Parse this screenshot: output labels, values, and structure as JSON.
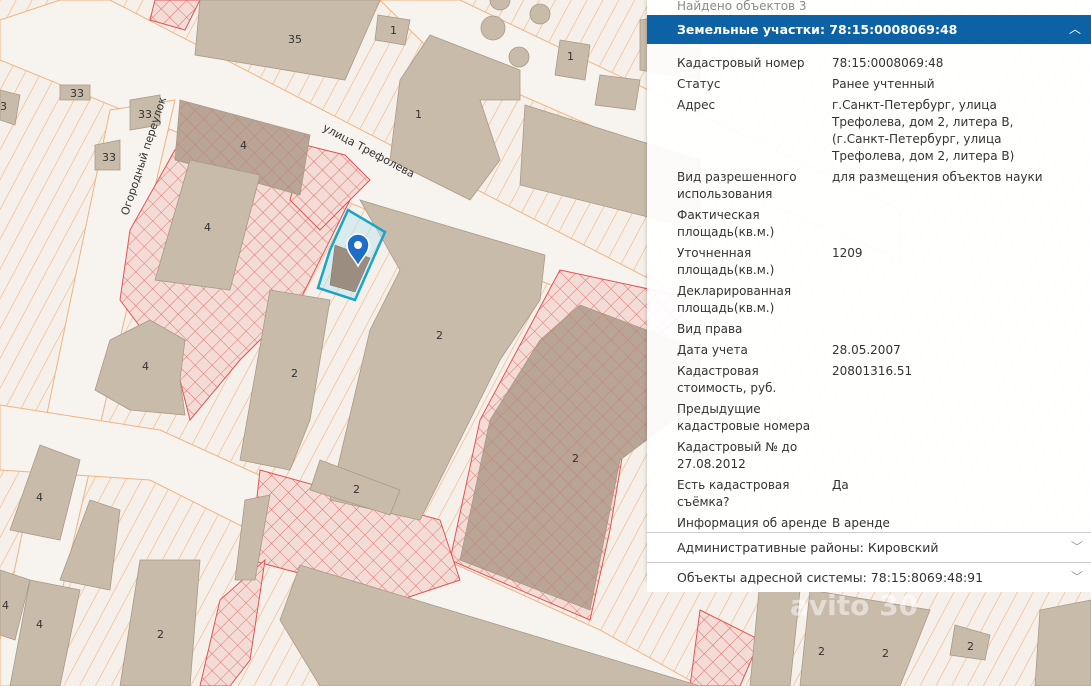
{
  "map": {
    "streets": [
      {
        "name": "улица Трефолева"
      },
      {
        "name": "Огородный переулок"
      }
    ],
    "building_numbers": [
      "35",
      "1",
      "1",
      "1",
      "33",
      "33",
      "33",
      "3",
      "4",
      "4",
      "4",
      "2",
      "2",
      "2",
      "2",
      "4",
      "4",
      "4",
      "2",
      "2",
      "2",
      "2"
    ],
    "watermark": "avito 30"
  },
  "panel": {
    "found_text": "Найдено объектов 3",
    "section_title": "Земельные участки: 78:15:0008069:48",
    "details": [
      {
        "label": "Кадастровый номер",
        "value": "78:15:0008069:48"
      },
      {
        "label": "Статус",
        "value": "Ранее учтенный"
      },
      {
        "label": "Адрес",
        "value": "г.Санкт-Петербург, улица Трефолева, дом 2, литера В, (г.Санкт-Петербург, улица Трефолева, дом 2, литера В)"
      },
      {
        "label": "Вид разрешенного использования",
        "value": "для размещения объектов науки"
      },
      {
        "label": "Фактическая площадь(кв.м.)",
        "value": ""
      },
      {
        "label": "Уточненная площадь(кв.м.)",
        "value": "1209"
      },
      {
        "label": "Декларированная площадь(кв.м.)",
        "value": ""
      },
      {
        "label": "Вид права",
        "value": ""
      },
      {
        "label": "Дата учета",
        "value": "28.05.2007"
      },
      {
        "label": "Кадастровая стоимость, руб.",
        "value": "20801316.51"
      },
      {
        "label": "Предыдущие кадастровые номера",
        "value": ""
      },
      {
        "label": "Кадастровый № до 27.08.2012",
        "value": ""
      },
      {
        "label": "Есть кадастровая съёмка?",
        "value": "Да"
      },
      {
        "label": "Информация об аренде",
        "value": "В аренде"
      }
    ],
    "admin_districts": "Административные районы: Кировский",
    "address_objects": "Объекты адресной системы: 78:15:8069:48:91",
    "colors": {
      "header": "#0c62a4",
      "parcel_line": "#f0b481",
      "hatch": "#e05555",
      "building": "#c8bbaa",
      "highlight": "#1aa5c8"
    }
  }
}
